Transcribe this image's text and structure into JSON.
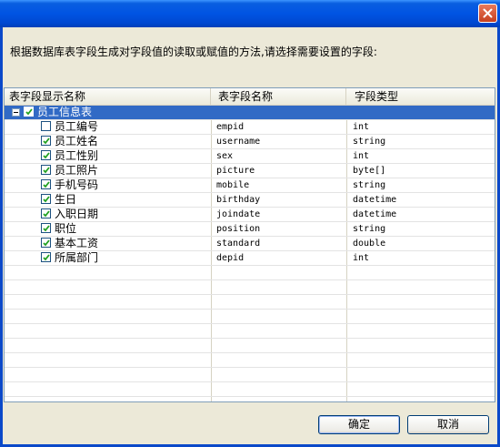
{
  "dialog": {
    "prompt": "根据数据库表字段生成对字段值的读取或赋值的方法,请选择需要设置的字段:"
  },
  "grid": {
    "columns": [
      "表字段显示名称",
      "表字段名称",
      "字段类型"
    ],
    "group": {
      "label": "员工信息表",
      "checked": true,
      "expanded": true
    },
    "rows": [
      {
        "display": "员工编号",
        "field": "empid",
        "type": "int",
        "checked": false
      },
      {
        "display": "员工姓名",
        "field": "username",
        "type": "string",
        "checked": true
      },
      {
        "display": "员工性别",
        "field": "sex",
        "type": "int",
        "checked": true
      },
      {
        "display": "员工照片",
        "field": "picture",
        "type": "byte[]",
        "checked": true
      },
      {
        "display": "手机号码",
        "field": "mobile",
        "type": "string",
        "checked": true
      },
      {
        "display": "生日",
        "field": "birthday",
        "type": "datetime",
        "checked": true
      },
      {
        "display": "入职日期",
        "field": "joindate",
        "type": "datetime",
        "checked": true
      },
      {
        "display": "职位",
        "field": "position",
        "type": "string",
        "checked": true
      },
      {
        "display": "基本工资",
        "field": "standard",
        "type": "double",
        "checked": true
      },
      {
        "display": "所属部门",
        "field": "depid",
        "type": "int",
        "checked": true
      }
    ]
  },
  "buttons": {
    "ok": "确定",
    "cancel": "取消"
  },
  "colors": {
    "titlebar": "#0054e3",
    "selection": "#316ac5",
    "check": "#21a121"
  },
  "icons": {
    "close": "close-icon",
    "check": "check-icon",
    "collapse": "minus-expander-icon"
  }
}
